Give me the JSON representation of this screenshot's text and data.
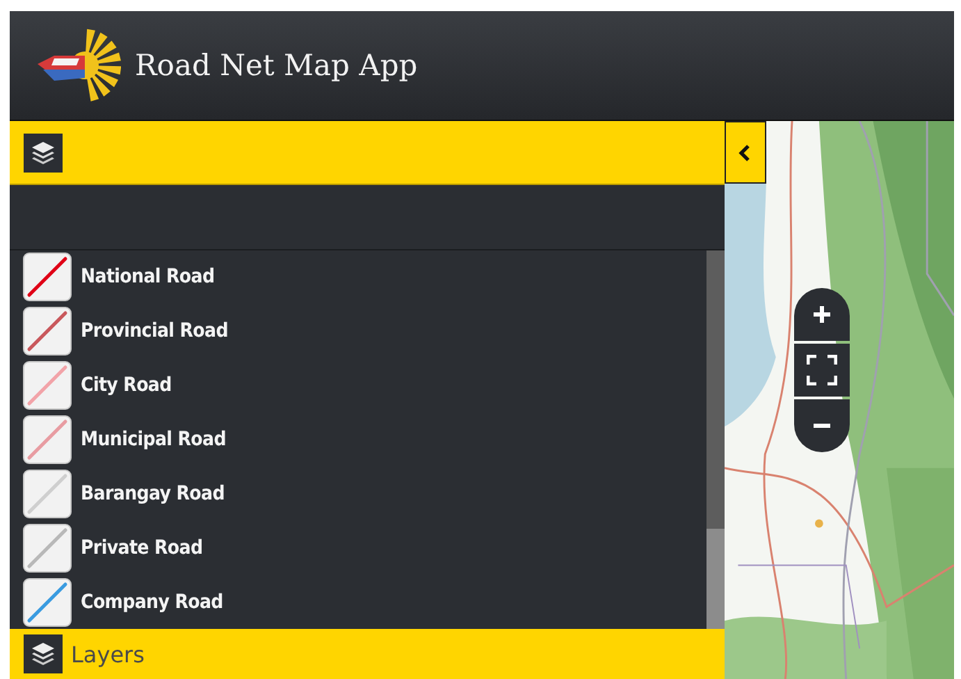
{
  "header": {
    "title": "Road Net Map App"
  },
  "legend": {
    "items": [
      {
        "label": "National Road",
        "color": "#e00016"
      },
      {
        "label": "Provincial Road",
        "color": "#c9585c"
      },
      {
        "label": "City Road",
        "color": "#f2a3a8"
      },
      {
        "label": "Municipal Road",
        "color": "#e89ca2"
      },
      {
        "label": "Barangay Road",
        "color": "#cfcfcf"
      },
      {
        "label": "Private Road",
        "color": "#b8b8b8"
      },
      {
        "label": "Company Road",
        "color": "#3a9be0"
      }
    ]
  },
  "footer": {
    "label": "Layers"
  }
}
